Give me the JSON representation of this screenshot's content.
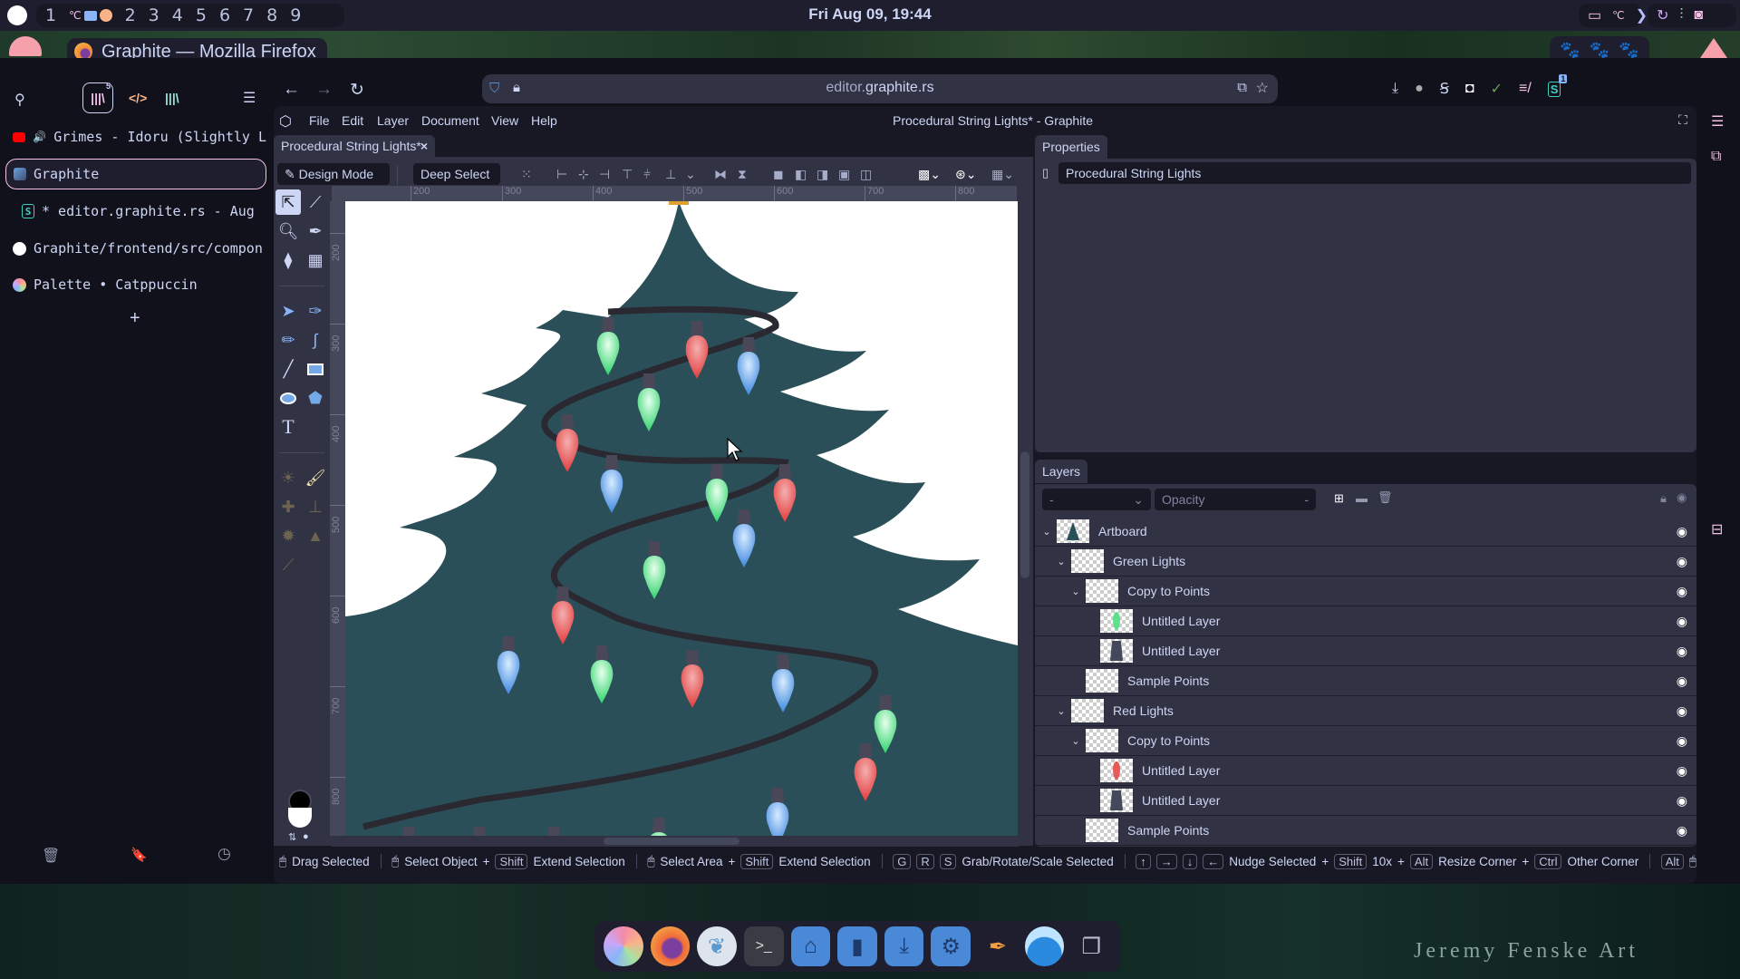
{
  "system_bar": {
    "workspaces": [
      "1",
      "2",
      "3",
      "4",
      "5",
      "6",
      "7",
      "8",
      "9"
    ],
    "clock": "Fri Aug 09, 19:44",
    "tray_icons": [
      "screen-icon",
      "vencord-icon",
      "chevron-right-icon",
      "refresh-icon",
      "equalizer-icon",
      "camera-icon"
    ]
  },
  "window_title": "Graphite — Mozilla Firefox",
  "firefox": {
    "url_domain_prefix": "editor.",
    "url_domain_main": "graphite.rs",
    "sidebar": {
      "tabs": [
        {
          "label": "Grimes - Idoru (Slightly L",
          "icon": "youtube-icon",
          "playing": true
        },
        {
          "label": "Graphite",
          "icon": "graphite-icon",
          "active": true
        },
        {
          "label": "* editor.graphite.rs - Aug",
          "icon": "stylus-icon"
        },
        {
          "label": "Graphite/frontend/src/compon",
          "icon": "github-icon"
        },
        {
          "label": "Palette • Catppuccin",
          "icon": "catppuccin-icon"
        }
      ],
      "new_tab_label": "+",
      "badge_count": "5"
    },
    "extension_badge": "1"
  },
  "graphite": {
    "menu": [
      "File",
      "Edit",
      "Layer",
      "Document",
      "View",
      "Help"
    ],
    "window_title": "Procedural String Lights* - Graphite",
    "document_tab": "Procedural String Lights*",
    "mode_dropdown": "Design Mode",
    "select_dropdown": "Deep Select",
    "ruler_h_labels": [
      "200",
      "300",
      "400",
      "500",
      "600",
      "700",
      "800"
    ],
    "ruler_v_labels": [
      "200",
      "300",
      "400",
      "500",
      "600",
      "700",
      "800"
    ],
    "properties": {
      "tab": "Properties",
      "document_name": "Procedural String Lights"
    },
    "layers": {
      "tab": "Layers",
      "blend_mode": "-",
      "opacity_placeholder": "Opacity",
      "opacity_value": "-",
      "rows": [
        {
          "name": "Artboard",
          "depth": 0,
          "expanded": true,
          "thumb": "tree"
        },
        {
          "name": "Green Lights",
          "depth": 1,
          "expanded": true,
          "thumb": "empty"
        },
        {
          "name": "Copy to Points",
          "depth": 2,
          "expanded": true,
          "thumb": "empty"
        },
        {
          "name": "Untitled Layer",
          "depth": 3,
          "thumb": "green-bulb"
        },
        {
          "name": "Untitled Layer",
          "depth": 3,
          "thumb": "socket"
        },
        {
          "name": "Sample Points",
          "depth": 2,
          "thumb": "empty"
        },
        {
          "name": "Red Lights",
          "depth": 1,
          "expanded": true,
          "thumb": "empty"
        },
        {
          "name": "Copy to Points",
          "depth": 2,
          "expanded": true,
          "thumb": "empty"
        },
        {
          "name": "Untitled Layer",
          "depth": 3,
          "thumb": "red-bulb"
        },
        {
          "name": "Untitled Layer",
          "depth": 3,
          "thumb": "socket"
        },
        {
          "name": "Sample Points",
          "depth": 2,
          "thumb": "empty"
        }
      ]
    },
    "status_bar": {
      "drag_selected": "Drag Selected",
      "select_object": "Select Object",
      "shift": "Shift",
      "extend_selection": "Extend Selection",
      "select_area": "Select Area",
      "keys_grs": [
        "G",
        "R",
        "S"
      ],
      "grab_rotate_scale": "Grab/Rotate/Scale Selected",
      "nudge_selected": "Nudge Selected",
      "ten_x": "10x",
      "alt": "Alt",
      "resize_corner": "Resize Corner",
      "ctrl": "Ctrl",
      "other_corner": "Other Corner",
      "plus": "+"
    },
    "colors": {
      "primary": "#000000",
      "secondary": "#ffffff",
      "tree": "#2b4f58",
      "wire": "#2a2830",
      "bulb_green": "#5ee08a",
      "bulb_red": "#e85a5a",
      "bulb_blue": "#5b9be6"
    }
  },
  "dock": {
    "apps": [
      "cat-app-icon",
      "firefox-icon",
      "coral-icon",
      "terminal-icon",
      "home-folder-icon",
      "documents-folder-icon",
      "downloads-folder-icon",
      "settings-folder-icon",
      "color-picker-icon",
      "water-icon",
      "window-switch-icon"
    ]
  },
  "wallpaper_signature": "Jeremy Fenske Art"
}
